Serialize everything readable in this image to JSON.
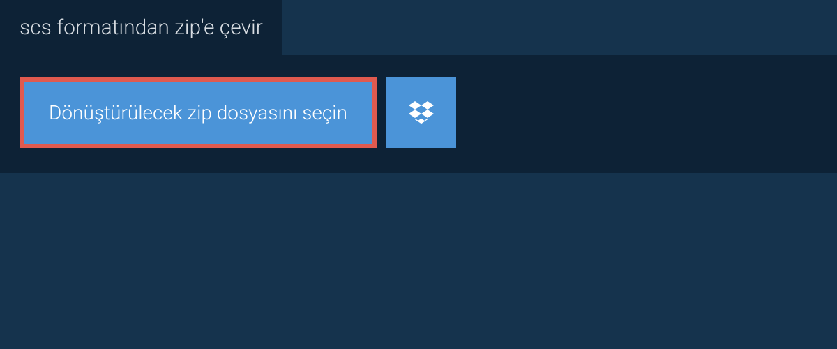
{
  "header": {
    "title": "scs formatından zip'e çevir"
  },
  "actions": {
    "select_file_label": "Dönüştürülecek zip dosyasını seçin"
  },
  "colors": {
    "background": "#15334d",
    "panel": "#0d2236",
    "button": "#4b94d8",
    "highlight_border": "#e05a4f",
    "text_light": "#d8dde2",
    "text_white": "#ffffff"
  }
}
